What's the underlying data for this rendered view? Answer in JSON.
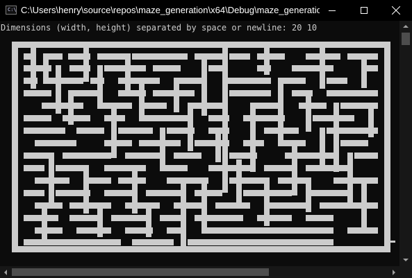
{
  "window": {
    "title": "C:\\Users\\henry\\source\\repos\\maze_generation\\x64\\Debug\\maze_generation....",
    "icon": "console-app-icon",
    "icon_text": "C:\\",
    "buttons": [
      "minimize-icon",
      "maximize-icon",
      "close-icon"
    ]
  },
  "console": {
    "prompt": "Dimensions (width, height) separated by space or newline: ",
    "input": "20 10",
    "foreground_color": "#cccccc",
    "background_color": "#0c0c0c"
  },
  "maze": {
    "width": 20,
    "height": 10,
    "path_color": "#cccccc",
    "wall_color": "#0c0c0c"
  }
}
